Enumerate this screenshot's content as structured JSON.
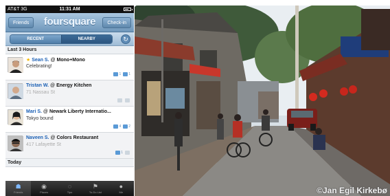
{
  "status": {
    "carrier": "AT&T 3G",
    "time": "11:31 AM",
    "battery_level": 0.7
  },
  "navbar": {
    "left_button": "Friends",
    "logo": "foursquare",
    "right_button": "Check-in"
  },
  "segment": {
    "options": [
      "RECENT",
      "NEARBY"
    ],
    "selected": "NEARBY"
  },
  "sections": {
    "last3": "Last 3 Hours",
    "today": "Today"
  },
  "checkins": [
    {
      "user": "Sean S.",
      "venue": "Mono+Mono",
      "detail": "Celebrating!",
      "badges": [
        "1",
        "1"
      ],
      "mayor": true
    },
    {
      "user": "Tristan W.",
      "venue": "Energy Kitchen",
      "detail": "71 Nassau St",
      "badges": [
        "",
        ""
      ]
    },
    {
      "user": "Mari S.",
      "venue": "Newark Liberty Internatio...",
      "detail": "Tokyo bound",
      "badges": [
        "4",
        "2"
      ]
    },
    {
      "user": "Naveen S.",
      "venue": "Colors Restaurant",
      "detail": "417 Lafayette St",
      "badges": [
        "1",
        ""
      ]
    }
  ],
  "tabbar": [
    {
      "label": "Friends",
      "icon": "people-icon"
    },
    {
      "label": "Places",
      "icon": "pin-icon"
    },
    {
      "label": "Tips",
      "icon": "lightbulb-icon"
    },
    {
      "label": "To-Do List",
      "icon": "flag-icon"
    },
    {
      "label": "Me",
      "icon": "person-icon"
    }
  ],
  "photo": {
    "credit": "©Jan Egil Kirkebø"
  },
  "colors": {
    "nav_blue": "#6f97bb",
    "link_blue": "#1a5fb4",
    "mayor_star": "#f5b800"
  }
}
